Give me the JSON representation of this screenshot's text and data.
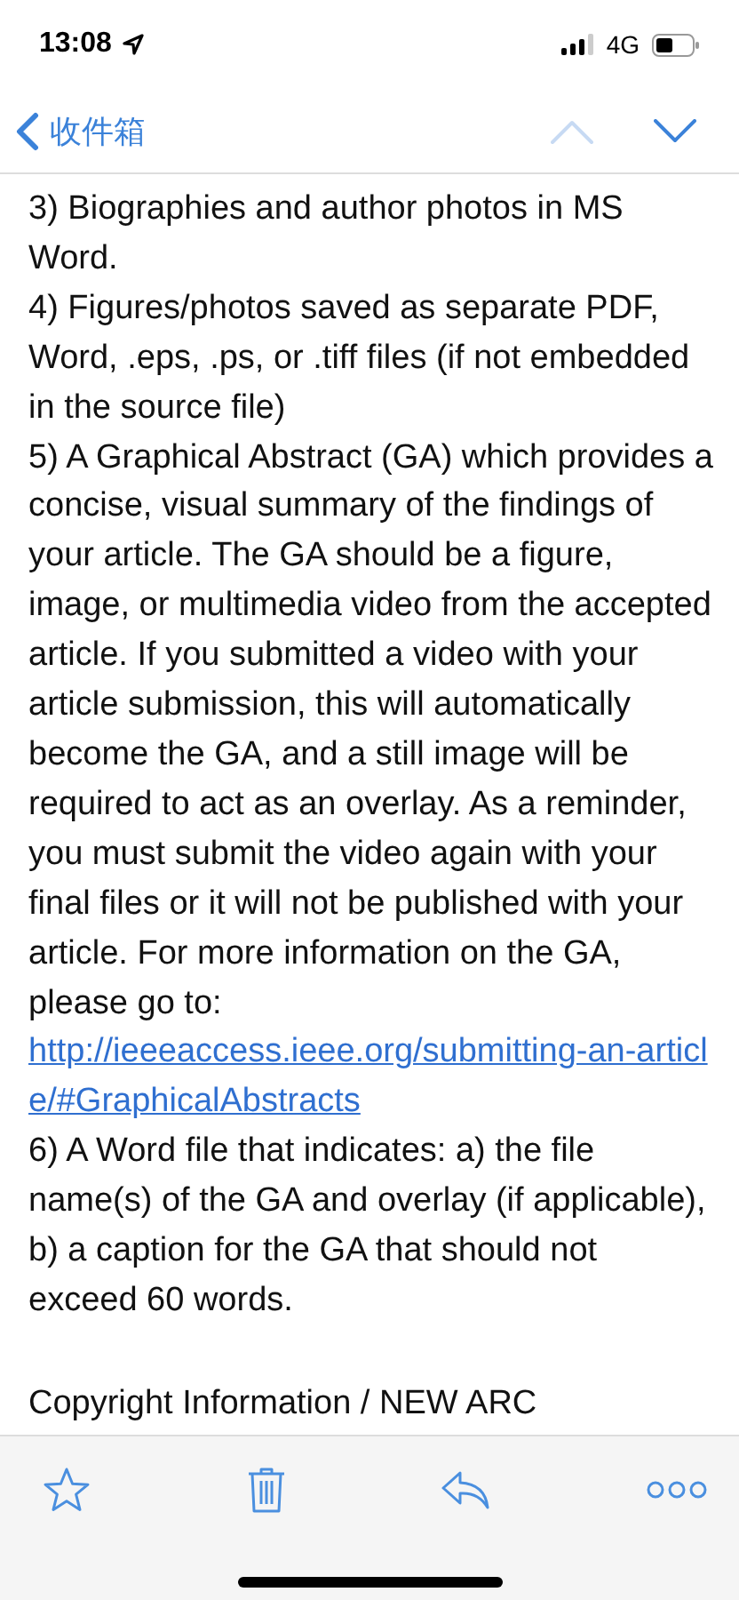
{
  "status_bar": {
    "time": "13:08",
    "network": "4G"
  },
  "nav": {
    "back_label": "收件箱",
    "previous_disabled": true,
    "next_disabled": false
  },
  "body": {
    "items": [
      {
        "text": "3) Biographies and author photos in MS Word."
      },
      {
        "text": "4) Figures/photos saved as separate PDF, Word, .eps, .ps, or .tiff files (if not embedded in the source file)"
      },
      {
        "text": "5) A Graphical Abstract (GA) which provides a concise, visual summary of the findings of your article. The GA should be a figure, image, or multimedia video from the accepted article. If you submitted a video with your article submission, this will automatically become the GA, and a still image will  be required to act as an overlay.  As a reminder, you must submit the video again with your final files or it will not be published with your article.  For more information on the GA, please go to:",
        "link": "http://ieeeaccess.ieee.org/submitting-an-article/#GraphicalAbstracts"
      },
      {
        "text": "6) A Word file that indicates: a) the file name(s) of the GA and overlay (if applicable), b) a caption for the GA that should not exceed 60 words."
      }
    ],
    "cut_heading": "Copyright Information / NEW ARC"
  }
}
